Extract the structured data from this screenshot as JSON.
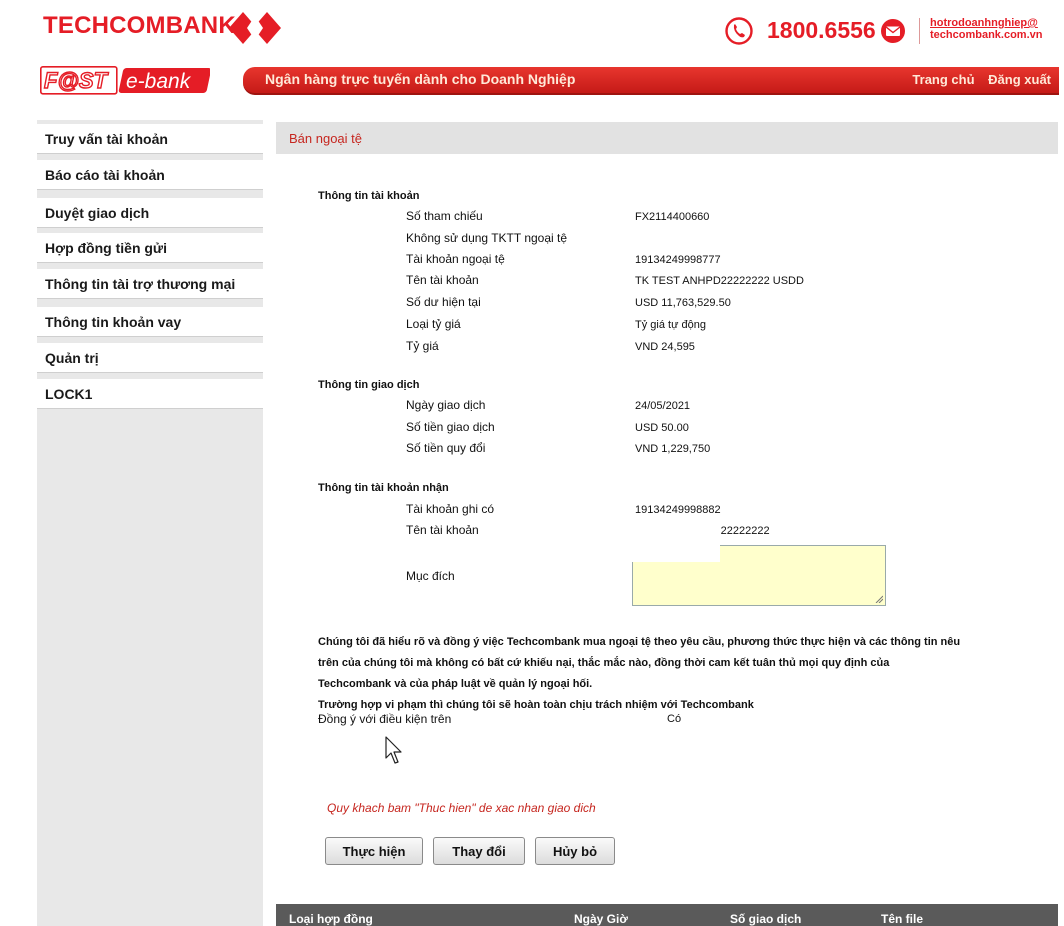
{
  "header": {
    "brand": "TECHCOMBANK",
    "hotline": "1800.6556",
    "support_email_line1": "hotrodoanhnghiep@",
    "support_email_line2": "techcombank.com.vn",
    "icons": [
      "techcombank-diamond-logo",
      "phone-icon",
      "mail-icon"
    ],
    "brand_color": "#e51d26"
  },
  "banner": {
    "product": "F@ST e-bank",
    "title": "Ngân hàng trực tuyến dành cho Doanh Nghiệp",
    "home": "Trang chủ",
    "logout": "Đăng xuất"
  },
  "sidebar": {
    "items": [
      {
        "label": "Truy vấn tài khoản"
      },
      {
        "label": "Báo cáo tài khoản"
      },
      {
        "label": "Duyệt giao dịch"
      },
      {
        "label": "Hợp đồng tiền gửi"
      },
      {
        "label": "Thông tin tài trợ thương mại"
      },
      {
        "label": "Thông tin khoản vay"
      },
      {
        "label": "Quản trị"
      },
      {
        "label": "LOCK1"
      }
    ]
  },
  "page": {
    "title": "Bán ngoại tệ"
  },
  "account_info": {
    "section": "Thông tin tài khoản",
    "fields": [
      {
        "label": "Số tham chiếu",
        "value": "FX2114400660"
      },
      {
        "label": "Không sử dụng TKTT ngoại tệ",
        "value": ""
      },
      {
        "label": "Tài khoản ngoại tệ",
        "value": "19134249998777"
      },
      {
        "label": "Tên tài khoản",
        "value": "TK TEST ANHPD22222222 USDD"
      },
      {
        "label": "Số dư hiện tại",
        "value": "USD 11,763,529.50"
      },
      {
        "label": "Loại tỷ giá",
        "value": "Tỷ giá tự động"
      },
      {
        "label": "Tỷ giá",
        "value": "VND 24,595"
      }
    ]
  },
  "transaction_info": {
    "section": "Thông tin giao dịch",
    "fields": [
      {
        "label": "Ngày giao dịch",
        "value": "24/05/2021"
      },
      {
        "label": "Số tiền giao dịch",
        "value": "USD 50.00"
      },
      {
        "label": "Số tiền quy đổi",
        "value": "VND 1,229,750"
      }
    ]
  },
  "receiver_info": {
    "section": "Thông tin tài khoản nhận",
    "fields": [
      {
        "label": "Tài khoản ghi có",
        "value": "19134249998882"
      },
      {
        "label": "Tên tài khoản",
        "value": ")22222222"
      },
      {
        "label": "Mục đích",
        "value": ""
      }
    ]
  },
  "terms": {
    "line1": "Chúng tôi đã hiểu rõ và đồng ý việc Techcombank mua ngoại tệ theo yêu cầu, phương thức thực hiện và các thông tin nêu",
    "line2": "trên của chúng tôi mà không có bất cứ khiếu nại, thắc mắc nào, đồng thời cam kết tuân thủ mọi quy định của",
    "line3": "Techcombank và của pháp luật về quản lý ngoại hối.",
    "line4": "Trường hợp vi phạm thì chúng tôi sẽ hoàn toàn chịu trách nhiệm với Techcombank",
    "agree_label": "Đồng ý với điều kiện trên",
    "agree_value": "Có"
  },
  "hint": "Quy khach bam \"Thuc hien\" de xac nhan giao dich",
  "buttons": {
    "submit": "Thực hiện",
    "change": "Thay đổi",
    "cancel": "Hủy bỏ"
  },
  "table": {
    "columns": [
      "Loại hợp đồng",
      "Ngày Giờ",
      "Số giao dịch",
      "Tên file"
    ]
  }
}
